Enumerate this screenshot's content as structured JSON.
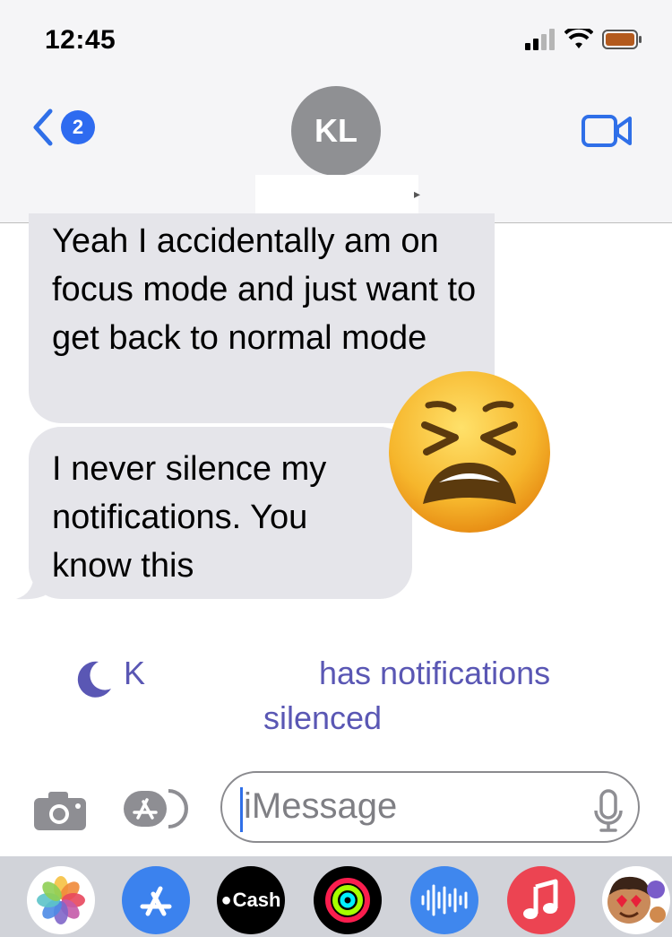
{
  "status_bar": {
    "time": "12:45"
  },
  "header": {
    "back_badge": "2",
    "avatar_initials": "KL"
  },
  "messages": [
    {
      "text": "Yeah I accidentally am on focus mode and just want to get back to normal mode"
    },
    {
      "text": "I never silence my notifications. You know this"
    }
  ],
  "focus_notice": {
    "name": "K",
    "text_line1": "has notifications",
    "text_line2": "silenced"
  },
  "compose": {
    "placeholder": "iMessage"
  },
  "apps": {
    "cash_label": "Cash"
  },
  "colors": {
    "accent": "#2f6fe8",
    "bubble": "#e5e5ea",
    "focus": "#5a57b4"
  },
  "icons": [
    "back-chevron-icon",
    "facetime-video-icon",
    "camera-icon",
    "app-store-icon",
    "microphone-icon",
    "moon-icon",
    "tired-face-emoji"
  ]
}
